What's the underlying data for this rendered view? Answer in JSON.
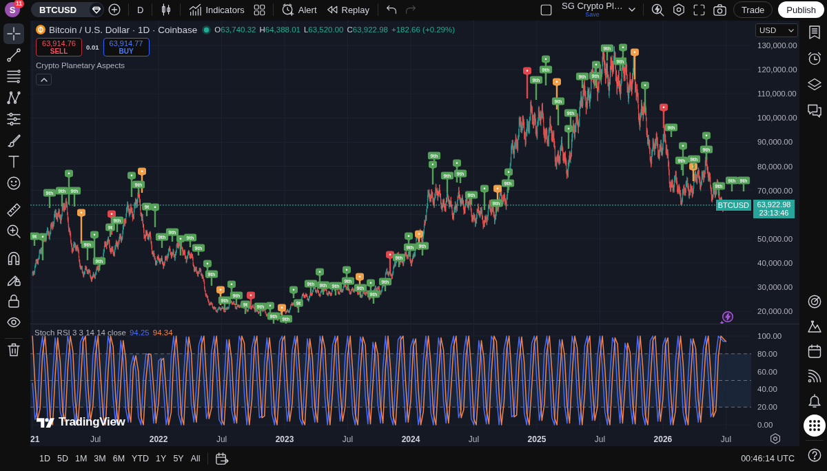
{
  "top_bar": {
    "avatar": {
      "initial": "S",
      "badge": "11"
    },
    "symbol": "BTCUSD",
    "interval": "D",
    "indicators": "Indicators",
    "alert": "Alert",
    "replay": "Replay",
    "undo": {
      "disabled": false
    },
    "redo": {
      "disabled": true
    },
    "layout": {
      "name": "SG Crypto Pl…",
      "save": "Save"
    },
    "trade": "Trade",
    "publish": "Publish"
  },
  "left_toolbar": {
    "tools": [
      {
        "selected": true
      },
      {
        "selected": false
      },
      {
        "selected": false
      },
      {
        "selected": false
      },
      {
        "selected": false
      },
      {
        "selected": false
      },
      {
        "selected": false
      },
      {
        "selected": false
      },
      {
        "selected": false
      },
      {
        "selected": false
      },
      {
        "selected": false
      },
      {
        "selected": false
      },
      {
        "selected": false
      },
      {
        "selected": false
      },
      {
        "selected": false
      }
    ]
  },
  "chart": {
    "legend": {
      "title": "Bitcoin / U.S. Dollar · 1D · Coinbase",
      "ohlc": [
        {
          "key": "O",
          "value": "63,740.32"
        },
        {
          "key": "H",
          "value": "64,388.01"
        },
        {
          "key": "L",
          "value": "63,520.00"
        },
        {
          "key": "C",
          "value": "63,922.98"
        }
      ],
      "change": "+182.66 (+0.29%)"
    },
    "sell": {
      "price": "63,914.76",
      "label": "SELL"
    },
    "spread": "0.01",
    "buy": {
      "price": "63,914.77",
      "label": "BUY"
    },
    "indicator": "Crypto Planetary Aspects",
    "currency": "USD",
    "price_tag": {
      "symbol": "BTCUSD",
      "price": "63,922.98",
      "countdown": "23:13:46"
    },
    "logo": "TradingView",
    "price_axis": [
      "130,000.00",
      "120,000.00",
      "110,000.00",
      "100,000.00",
      "90,000.00",
      "80,000.00",
      "70,000.00",
      "50,000.00",
      "40,000.00",
      "30,000.00",
      "20,000.00"
    ],
    "aspect_flags": [
      {
        "text": "9t",
        "color": "#55a15a"
      },
      {
        "color": "#55a15a"
      },
      {
        "text": "9th",
        "color": "#55a15a"
      },
      {
        "text": "9th",
        "color": "#55a15a"
      },
      {
        "color": "#55a15a"
      },
      {
        "text": "9th",
        "color": "#55a15a"
      },
      {
        "color": "#f0a04b"
      },
      {
        "text": "9th",
        "color": "#55a15a"
      },
      {
        "color": "#55a15a"
      },
      {
        "text": "9th",
        "color": "#55a15a"
      },
      {
        "color": "#e0474c"
      },
      {
        "text": "9t",
        "color": "#55a15a"
      },
      {
        "text": "9th",
        "color": "#55a15a"
      },
      {
        "color": "#55a15a"
      },
      {
        "color": "#f0a04b"
      },
      {
        "text": "9th",
        "color": "#55a15a"
      },
      {
        "text": "9t",
        "color": "#55a15a"
      },
      {
        "color": "#55a15a"
      },
      {
        "text": "9th",
        "color": "#55a15a"
      },
      {
        "text": "9th",
        "color": "#55a15a"
      },
      {
        "color": "#55a15a"
      },
      {
        "text": "9th",
        "color": "#55a15a"
      },
      {
        "text": "9th",
        "color": "#55a15a"
      },
      {
        "color": "#55a15a"
      },
      {
        "text": "9th",
        "color": "#55a15a"
      },
      {
        "color": "#f0a04b"
      },
      {
        "text": "9th",
        "color": "#55a15a"
      },
      {
        "color": "#55a15a"
      },
      {
        "text": "9th",
        "color": "#55a15a"
      },
      {
        "text": "9t",
        "color": "#55a15a"
      },
      {
        "color": "#e0474c"
      },
      {
        "text": "9th",
        "color": "#55a15a"
      },
      {
        "color": "#55a15a"
      },
      {
        "text": "9th",
        "color": "#55a15a"
      },
      {
        "color": "#f0a04b"
      },
      {
        "text": "9th",
        "color": "#55a15a"
      },
      {
        "color": "#55a15a"
      },
      {
        "text": "9t",
        "color": "#55a15a"
      },
      {
        "text": "9th",
        "color": "#55a15a"
      },
      {
        "color": "#55a15a"
      },
      {
        "text": "9th",
        "color": "#55a15a"
      },
      {
        "text": "9th",
        "color": "#55a15a"
      },
      {
        "color": "#55a15a"
      },
      {
        "text": "9th",
        "color": "#55a15a"
      },
      {
        "color": "#f0a04b"
      },
      {
        "text": "9th",
        "color": "#55a15a"
      },
      {
        "color": "#55a15a"
      },
      {
        "text": "9th",
        "color": "#55a15a"
      },
      {
        "text": "9th",
        "color": "#55a15a"
      },
      {
        "color": "#e0474c"
      },
      {
        "text": "9th",
        "color": "#55a15a"
      },
      {
        "color": "#55a15a"
      },
      {
        "text": "9th",
        "color": "#55a15a"
      },
      {
        "color": "#f0a04b"
      },
      {
        "text": "9th",
        "color": "#55a15a"
      },
      {
        "color": "#55a15a"
      },
      {
        "text": "9th",
        "color": "#55a15a"
      },
      {
        "text": "9th",
        "color": "#55a15a"
      },
      {
        "color": "#55a15a"
      },
      {
        "text": "9th",
        "color": "#55a15a"
      },
      {
        "text": "9th",
        "color": "#55a15a"
      },
      {
        "color": "#55a15a"
      },
      {
        "color": "#f0a04b"
      },
      {
        "text": "9th",
        "color": "#55a15a"
      },
      {
        "color": "#55a15a"
      },
      {
        "text": "9th",
        "color": "#55a15a"
      },
      {
        "color": "#e0474c"
      },
      {
        "text": "9th",
        "color": "#55a15a"
      },
      {
        "color": "#55a15a"
      },
      {
        "text": "9th",
        "color": "#55a15a"
      },
      {
        "color": "#f0a04b"
      },
      {
        "text": "9th",
        "color": "#55a15a"
      },
      {
        "color": "#55a15a"
      },
      {
        "text": "9th",
        "color": "#55a15a"
      },
      {
        "text": "9th",
        "color": "#55a15a"
      },
      {
        "color": "#55a15a"
      },
      {
        "text": "9th",
        "color": "#55a15a"
      },
      {
        "text": "9th",
        "color": "#55a15a"
      },
      {
        "color": "#55a15a"
      },
      {
        "text": "9th",
        "color": "#55a15a"
      },
      {
        "color": "#f0a04b"
      },
      {
        "color": "#55a15a"
      },
      {
        "color": "#e0474c"
      },
      {
        "text": "9th",
        "color": "#55a15a"
      },
      {
        "color": "#55a15a"
      },
      {
        "text": "9th",
        "color": "#55a15a"
      },
      {
        "color": "#f0a04b"
      },
      {
        "text": "9th",
        "color": "#55a15a"
      },
      {
        "color": "#55a15a"
      },
      {
        "text": "9th",
        "color": "#55a15a"
      },
      {
        "text": "9th",
        "color": "#55a15a"
      },
      {
        "text": "9th",
        "color": "#55a15a"
      },
      {
        "text": "9th",
        "color": "#55a15a"
      }
    ],
    "chart_data": {
      "type": "other"
    }
  },
  "stoch_rsi": {
    "title": "Stoch RSI 3 3 14 14 close",
    "values": [
      {
        "text": "94.25"
      },
      {
        "text": "94.34"
      }
    ],
    "chart_data": {
      "type": "line",
      "grid": true,
      "x": [
        2021,
        2021.02,
        2021.04,
        2021.06,
        2021.08,
        2021.1,
        2021.12,
        2021.14,
        2021.16,
        2021.18,
        2021.2,
        2021.22,
        2021.24,
        2021.26,
        2021.28,
        2021.3,
        2021.32,
        2021.34,
        2021.36,
        2021.38,
        2021.4,
        2021.42,
        2021.44,
        2021.46,
        2021.48,
        2021.5,
        2021.52,
        2021.54,
        2021.56,
        2021.58,
        2021.6,
        2021.62,
        2021.64,
        2021.66,
        2021.68,
        2021.7,
        2021.72,
        2021.74,
        2021.76,
        2021.78,
        2021.8,
        2021.82,
        2021.84,
        2021.86,
        2021.88,
        2021.9,
        2021.92,
        2021.94,
        2021.96,
        2021.98,
        2022,
        2022.02,
        2022.04,
        2022.06,
        2022.08,
        2022.1,
        2022.12,
        2022.14,
        2022.16,
        2022.18,
        2022.2,
        2022.22,
        2022.24,
        2022.26,
        2022.28,
        2022.3,
        2022.32,
        2022.34,
        2022.36,
        2022.38,
        2022.4,
        2022.42,
        2022.44,
        2022.46,
        2022.48,
        2022.5,
        2022.52,
        2022.54,
        2022.56,
        2022.58,
        2022.6,
        2022.62,
        2022.64,
        2022.66,
        2022.68,
        2022.7,
        2022.72,
        2022.74,
        2022.76,
        2022.78,
        2022.8,
        2022.82,
        2022.84,
        2022.86,
        2022.88,
        2022.9,
        2022.92,
        2022.94,
        2022.96,
        2022.98,
        2023,
        2023.02,
        2023.04,
        2023.06,
        2023.08,
        2023.1,
        2023.12,
        2023.14,
        2023.16,
        2023.18,
        2023.2,
        2023.22,
        2023.24,
        2023.26,
        2023.28,
        2023.3,
        2023.32,
        2023.34,
        2023.36,
        2023.38,
        2023.4,
        2023.42,
        2023.44,
        2023.46,
        2023.48,
        2023.5,
        2023.52,
        2023.54,
        2023.56,
        2023.58,
        2023.6,
        2023.62,
        2023.64,
        2023.66,
        2023.68,
        2023.7,
        2023.72,
        2023.74,
        2023.76,
        2023.78,
        2023.8,
        2023.82,
        2023.84,
        2023.86,
        2023.88,
        2023.9,
        2023.92,
        2023.94,
        2023.96,
        2023.98,
        2024,
        2024.02,
        2024.04,
        2024.06,
        2024.08,
        2024.1,
        2024.12,
        2024.14,
        2024.16,
        2024.18,
        2024.2,
        2024.22,
        2024.24,
        2024.26,
        2024.28,
        2024.3,
        2024.32,
        2024.34,
        2024.36,
        2024.38,
        2024.4,
        2024.42,
        2024.44,
        2024.46,
        2024.48,
        2024.5,
        2024.52,
        2024.54,
        2024.56,
        2024.58,
        2024.6,
        2024.62,
        2024.64,
        2024.66,
        2024.68,
        2024.7,
        2024.72,
        2024.74,
        2024.76,
        2024.78,
        2024.8,
        2024.82,
        2024.84,
        2024.86,
        2024.88,
        2024.9,
        2024.92,
        2024.94,
        2024.96,
        2024.98,
        2025,
        2025.02,
        2025.04,
        2025.06,
        2025.08,
        2025.1,
        2025.12,
        2025.14,
        2025.16,
        2025.18,
        2025.2,
        2025.22,
        2025.24,
        2025.26,
        2025.28,
        2025.3,
        2025.32,
        2025.34,
        2025.36,
        2025.38,
        2025.4,
        2025.42,
        2025.44,
        2025.46,
        2025.48,
        2025.5,
        2025.52,
        2025.54,
        2025.56,
        2025.58,
        2025.6,
        2025.62,
        2025.64,
        2025.66,
        2025.68,
        2025.7,
        2025.72,
        2025.74,
        2025.76,
        2025.78,
        2025.8,
        2025.82,
        2025.84,
        2025.86,
        2025.88,
        2025.9,
        2025.92,
        2025.94,
        2025.96,
        2025.98,
        2026,
        2026.02,
        2026.04,
        2026.06,
        2026.08,
        2026.1,
        2026.12,
        2026.14,
        2026.16,
        2026.18,
        2026.2,
        2026.22,
        2026.24,
        2026.26,
        2026.28,
        2026.3,
        2026.32,
        2026.34,
        2026.36,
        2026.38,
        2026.4,
        2026.42,
        2026.44,
        2026.46,
        2026.48,
        2026.5
      ],
      "series": [
        {
          "color": "#4a6cf5",
          "values": [
            47,
            6,
            18,
            80,
            100,
            62,
            9,
            0,
            54,
            98,
            71,
            15,
            4,
            63,
            100,
            83,
            26,
            0,
            40,
            93,
            100,
            44,
            5,
            22,
            79,
            100,
            56,
            10,
            0,
            60,
            100,
            88,
            30,
            1,
            48,
            95,
            74,
            18,
            3,
            66,
            78,
            60,
            9,
            0,
            52,
            80,
            79,
            43,
            2,
            25,
            72,
            75,
            38,
            0,
            14,
            76,
            100,
            65,
            11,
            0,
            57,
            99,
            81,
            23,
            3,
            44,
            90,
            100,
            51,
            7,
            19,
            82,
            100,
            60,
            6,
            0,
            49,
            96,
            73,
            16,
            2,
            61,
            100,
            92,
            34,
            0,
            28,
            87,
            100,
            55,
            8,
            10,
            70,
            98,
            68,
            12,
            0,
            45,
            94,
            100,
            47,
            4,
            24,
            84,
            100,
            58,
            7,
            0,
            52,
            97,
            76,
            20,
            3,
            59,
            100,
            86,
            30,
            0,
            37,
            90,
            100,
            42,
            4,
            21,
            78,
            100,
            61,
            12,
            0,
            58,
            99,
            90,
            33,
            1,
            46,
            93,
            79,
            22,
            2,
            64,
            100,
            63,
            10,
            0,
            50,
            96,
            100,
            46,
            3,
            27,
            88,
            97,
            40,
            0,
            15,
            73,
            100,
            67,
            13,
            0,
            55,
            98,
            84,
            26,
            2,
            42,
            88,
            100,
            53,
            8,
            17,
            80,
            100,
            63,
            7,
            0,
            47,
            95,
            75,
            18,
            1,
            59,
            100,
            94,
            36,
            0,
            26,
            85,
            100,
            57,
            9,
            11,
            72,
            99,
            70,
            13,
            0,
            43,
            92,
            100,
            49,
            5,
            23,
            83,
            100,
            60,
            8,
            0,
            50,
            96,
            78,
            22,
            2,
            57,
            100,
            87,
            32,
            0,
            35,
            89,
            100,
            45,
            5,
            20,
            76,
            100,
            63,
            14,
            0,
            56,
            98,
            91,
            35,
            2,
            44,
            92,
            81,
            24,
            1,
            62,
            100,
            65,
            11,
            0,
            48,
            95,
            100,
            48,
            4,
            29,
            90,
            98,
            42,
            0,
            16,
            71,
            100,
            69,
            14,
            0,
            53,
            97,
            86,
            28,
            3,
            40,
            86,
            100,
            55,
            9,
            16,
            78,
            100,
            97,
            94,
            94
          ]
        },
        {
          "color": "#f08550",
          "values": [
            100,
            47,
            6,
            18,
            80,
            100,
            62,
            9,
            0,
            54,
            98,
            71,
            15,
            4,
            63,
            100,
            83,
            26,
            0,
            40,
            93,
            100,
            44,
            5,
            22,
            79,
            100,
            56,
            10,
            0,
            60,
            100,
            88,
            30,
            1,
            48,
            95,
            74,
            18,
            3,
            66,
            78,
            60,
            9,
            0,
            52,
            80,
            79,
            43,
            2,
            25,
            72,
            75,
            38,
            0,
            14,
            76,
            100,
            65,
            11,
            0,
            57,
            99,
            81,
            23,
            3,
            44,
            90,
            100,
            51,
            7,
            19,
            82,
            100,
            60,
            6,
            0,
            49,
            96,
            73,
            16,
            2,
            61,
            100,
            92,
            34,
            0,
            28,
            87,
            100,
            55,
            8,
            10,
            70,
            98,
            68,
            12,
            0,
            45,
            94,
            100,
            47,
            4,
            24,
            84,
            100,
            58,
            7,
            0,
            52,
            97,
            76,
            20,
            3,
            59,
            100,
            86,
            30,
            0,
            37,
            90,
            100,
            42,
            4,
            21,
            78,
            100,
            61,
            12,
            0,
            58,
            99,
            90,
            33,
            1,
            46,
            93,
            79,
            22,
            2,
            64,
            100,
            63,
            10,
            0,
            50,
            96,
            100,
            46,
            3,
            27,
            88,
            97,
            40,
            0,
            15,
            73,
            100,
            67,
            13,
            0,
            55,
            98,
            84,
            26,
            2,
            42,
            88,
            100,
            53,
            8,
            17,
            80,
            100,
            63,
            7,
            0,
            47,
            95,
            75,
            18,
            1,
            59,
            100,
            94,
            36,
            0,
            26,
            85,
            100,
            57,
            9,
            11,
            72,
            99,
            70,
            13,
            0,
            43,
            92,
            100,
            49,
            5,
            23,
            83,
            100,
            60,
            8,
            0,
            50,
            96,
            78,
            22,
            2,
            57,
            100,
            87,
            32,
            0,
            35,
            89,
            100,
            45,
            5,
            20,
            76,
            100,
            63,
            14,
            0,
            56,
            98,
            91,
            35,
            2,
            44,
            92,
            81,
            24,
            1,
            62,
            100,
            65,
            11,
            0,
            48,
            95,
            100,
            48,
            4,
            29,
            90,
            98,
            42,
            0,
            16,
            71,
            100,
            69,
            14,
            0,
            53,
            97,
            86,
            28,
            3,
            40,
            86,
            100,
            55,
            9,
            16,
            78,
            100,
            97,
            94
          ]
        }
      ],
      "bands": [
        {
          "axis": "y",
          "from": 20,
          "to": 80
        }
      ],
      "xlim": [
        2020.983,
        2026.7
      ],
      "ylim": [
        -6.2,
        111.63
      ],
      "xticks": [
        {
          "value": 2021,
          "label": "21"
        },
        {
          "value": 2021.5,
          "label": "Jul"
        },
        {
          "value": 2022,
          "label": "2022"
        },
        {
          "value": 2022.5,
          "label": "Jul"
        },
        {
          "value": 2023,
          "label": "2023"
        },
        {
          "value": 2023.5,
          "label": "Jul"
        },
        {
          "value": 2024,
          "label": "2024"
        },
        {
          "value": 2024.5,
          "label": "Jul"
        },
        {
          "value": 2025,
          "label": "2025"
        },
        {
          "value": 2025.5,
          "label": "Jul"
        },
        {
          "value": 2026,
          "label": "2026"
        },
        {
          "value": 2026.5,
          "label": "Jul"
        }
      ],
      "yticks": [
        {
          "value": 100,
          "label": "100.00"
        },
        {
          "value": 80,
          "label": "80.00"
        },
        {
          "value": 60,
          "label": "60.00"
        },
        {
          "value": 40,
          "label": "40.00"
        },
        {
          "value": 20,
          "label": "20.00"
        },
        {
          "value": 0,
          "label": "0.00"
        }
      ]
    }
  },
  "bottom_bar": {
    "ranges": [
      "1D",
      "5D",
      "1M",
      "3M",
      "6M",
      "YTD",
      "1Y",
      "5Y",
      "All"
    ],
    "clock": "00:46:14 UTC"
  },
  "right_sidebar": {
    "top": [
      {
        "selected": false
      },
      {
        "selected": false
      },
      {
        "selected": false
      },
      {
        "selected": false
      }
    ],
    "bottom": [
      {
        "selected": false
      },
      {
        "selected": false
      },
      {
        "selected": false
      },
      {
        "selected": false
      },
      {
        "selected": false
      },
      {
        "selected": true
      },
      {
        "selected": false
      }
    ]
  }
}
